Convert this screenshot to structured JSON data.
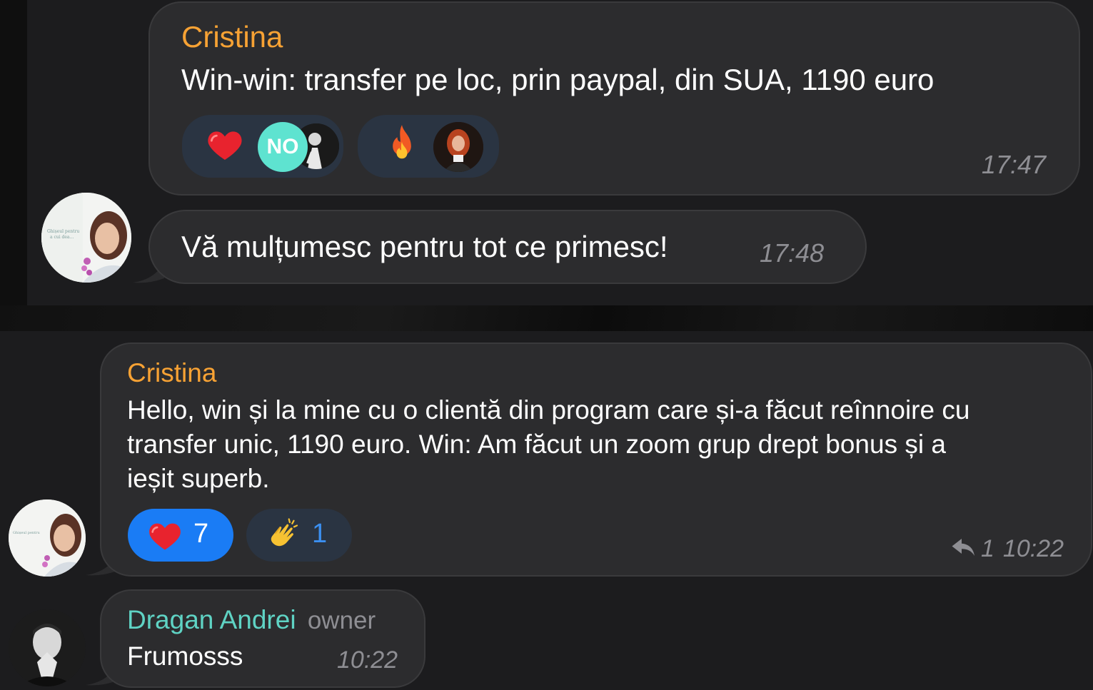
{
  "messages": [
    {
      "sender": "Cristina",
      "text": "Win-win: transfer pe loc, prin paypal, din SUA, 1190 euro",
      "time": "17:47",
      "reactions": [
        {
          "emoji": "heart-emoji",
          "avatars": [
            "NO",
            "user-photo"
          ]
        },
        {
          "emoji": "fire-emoji",
          "avatars": [
            "user-photo"
          ]
        }
      ]
    },
    {
      "text": "Vă mulțumesc pentru tot ce primesc!",
      "time": "17:48"
    },
    {
      "sender": "Cristina",
      "text_lines": [
        "Hello, win și la mine cu o clientă din program care și-a făcut reînnoire cu",
        "transfer unic, 1190 euro. Win: Am făcut un zoom grup drept bonus și a",
        "ieșit superb."
      ],
      "reactions": [
        {
          "emoji": "heart-emoji",
          "count": "7",
          "selected": true
        },
        {
          "emoji": "clap-emoji",
          "count": "1",
          "selected": false
        }
      ],
      "replies": "1",
      "time": "10:22"
    },
    {
      "sender": "Dragan Andrei",
      "role": "owner",
      "text": "Frumosss",
      "time": "10:22"
    }
  ],
  "colors": {
    "sender_orange": "#f7a234",
    "sender_teal": "#5fd3c4",
    "bubble": "#2c2c2e",
    "time": "#8e8e93",
    "reaction_selected": "#1a7cf5",
    "reaction_bg": "#2a3442",
    "link_blue": "#3b8ff0"
  }
}
